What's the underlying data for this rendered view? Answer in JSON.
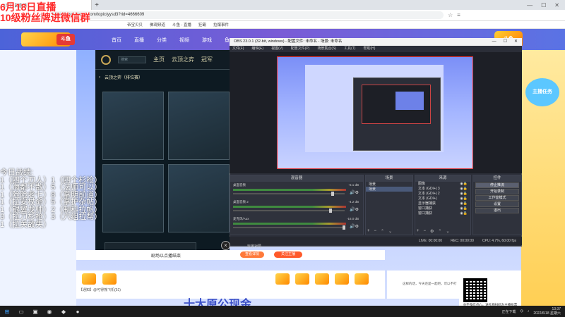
{
  "overlay": {
    "title": "6月18日直播",
    "subtitle": "10级粉丝牌进微信群",
    "record_title": "今日战绩:",
    "records": [
      "1（四个刀人）1（四个杉枪）",
      "1（海都不散）5（法师可以）",
      "1（险险老七）8（掌明前道）",
      "1（拉安杖命）5（掌护杂帖）",
      "1（银翼龙帅）2（制科拉帆）",
      "3（拉刀杉枪）3（六组拉帮）",
      "1（拉关故失）"
    ]
  },
  "browser": {
    "tab_title": "6月18日直播",
    "url": "https://www.douyu.com/topic/yysd3?rid=4666609",
    "bookmarks": [
      "帝宝贝贝",
      "佛观频道",
      "斗鱼 - 直播",
      "狂霸",
      "拉爆事件"
    ]
  },
  "site": {
    "logo_text": "斗鱼",
    "nav": [
      "首页",
      "直播",
      "分类",
      "视频",
      "游戏",
      "鱼"
    ],
    "right_logo": "斗鱼",
    "side_promo": "主播任务"
  },
  "lol": {
    "nav": [
      "主页",
      "云顶之弈",
      "冠军"
    ],
    "search_placeholder": "搜索",
    "subnav": "云顶之弈（排位赛）",
    "live_label": "玩家对局"
  },
  "obs": {
    "title": "OBS 23.0.1 (32-bit, windows) - 配置文件: 未命名 - 场景: 未命名",
    "menu": [
      "文件(F)",
      "编辑(E)",
      "视图(V)",
      "配置文件(P)",
      "场景集合(S)",
      "工具(T)",
      "帮助(H)"
    ],
    "docks": {
      "mixer": "混音器",
      "scenes": "场景",
      "sources": "来源",
      "controls": "控件"
    },
    "mixer_rows": [
      {
        "name": "桌面音频",
        "db": "-5.1 dB",
        "knob": 0.88
      },
      {
        "name": "桌面音频 2",
        "db": "-4.2 dB",
        "knob": 0.86
      },
      {
        "name": "麦克风/Aux",
        "db": "-16.0 dB",
        "knob": 0.98
      }
    ],
    "scenes": [
      "场景",
      "场景"
    ],
    "sources": [
      "图像",
      "文本 (GDI+) 3",
      "文本 (GDI+) 2",
      "文本 (GDI+)",
      "显示器捕获",
      "窗口捕获",
      "窗口捕获"
    ],
    "controls": [
      "停止推流",
      "开始录制",
      "工作室模式",
      "设置",
      "退出"
    ],
    "status": [
      "LIVE: 00:00:00",
      "REC: 00:00:00",
      "CPU: 4.7%, 60.00 fps"
    ]
  },
  "player": {
    "follow_text": "剧场以点播结束",
    "btn1": "查看详情",
    "btn2": "关注主播",
    "live_label": "实况直播"
  },
  "bottom": {
    "chat_line": "【通知】@可得熊飞机(51)",
    "banner": "十大原公现金",
    "qr_caption": "亦不多吃点心，送礼物扫码为主播投票",
    "note": "这样的话，今天还是一起吧，可以不打"
  },
  "taskbar": {
    "search": "",
    "status": "正在下载",
    "time": "13:37",
    "date": "2022/6/18 星期六"
  },
  "colors": {
    "accent": "#ff2a2a",
    "obs_bg": "#2b2e38",
    "site_header": "#5a6ae0"
  }
}
